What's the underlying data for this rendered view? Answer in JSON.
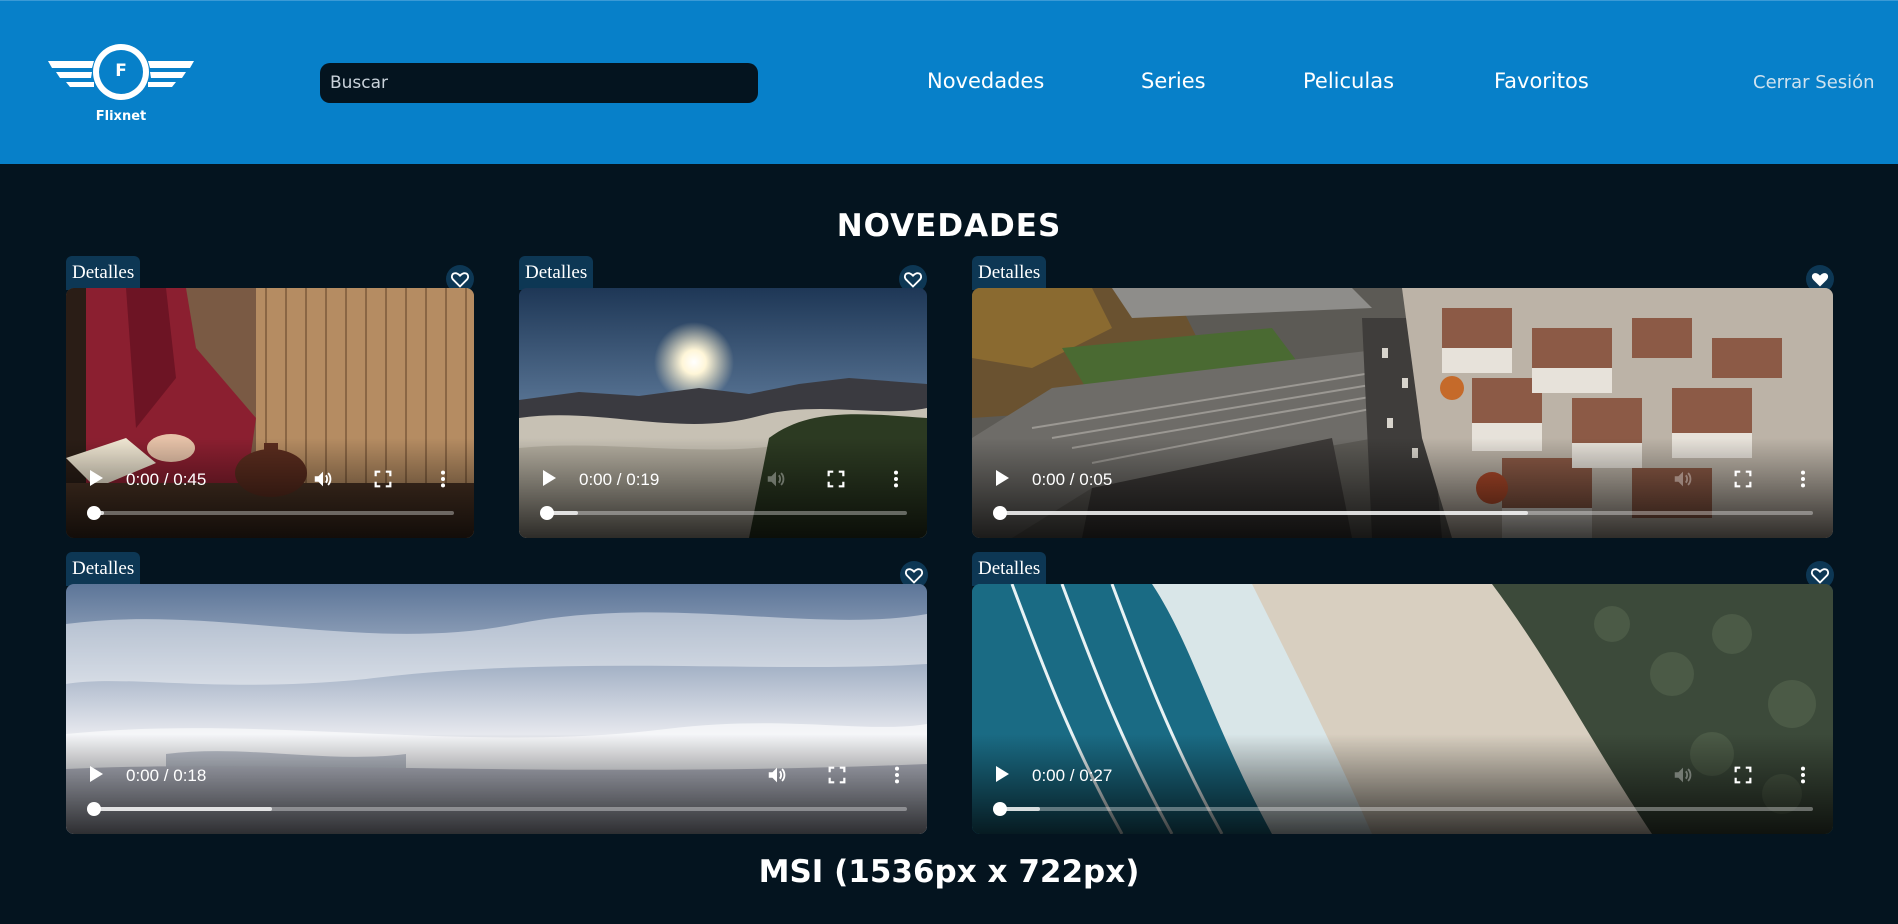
{
  "app": {
    "name": "Flixnet",
    "logo_letter": "F"
  },
  "search": {
    "placeholder": "Buscar"
  },
  "nav": {
    "items": [
      {
        "label": "Novedades"
      },
      {
        "label": "Series"
      },
      {
        "label": "Peliculas"
      },
      {
        "label": "Favoritos"
      }
    ],
    "logout": "Cerrar Sesión"
  },
  "section": {
    "title": "NOVEDADES"
  },
  "videos": [
    {
      "details_label": "Detalles",
      "time": "0:00 / 0:45",
      "favorited": false,
      "buffered_fraction": 0.03,
      "scene": "tea-ceremony"
    },
    {
      "details_label": "Detalles",
      "time": "0:00 / 0:19",
      "favorited": false,
      "buffered_fraction": 0.09,
      "scene": "sunrise-fog-mountains"
    },
    {
      "details_label": "Detalles",
      "time": "0:00 / 0:05",
      "favorited": true,
      "buffered_fraction": 0.65,
      "scene": "aerial-city-railway"
    },
    {
      "details_label": "Detalles",
      "time": "0:00 / 0:18",
      "favorited": false,
      "buffered_fraction": 0.22,
      "scene": "clouds-sky"
    },
    {
      "details_label": "Detalles",
      "time": "0:00 / 0:27",
      "favorited": false,
      "buffered_fraction": 0.05,
      "scene": "aerial-beach-waves"
    }
  ],
  "footer": {
    "text": "MSI (1536px x 722px)"
  },
  "colors": {
    "header": "#0780c9",
    "background": "#04141f",
    "badge": "#0d3754"
  },
  "icons": [
    "logo-wings-icon",
    "heart-icon",
    "heart-filled-icon",
    "play-icon",
    "volume-icon",
    "fullscreen-icon",
    "more-icon"
  ]
}
